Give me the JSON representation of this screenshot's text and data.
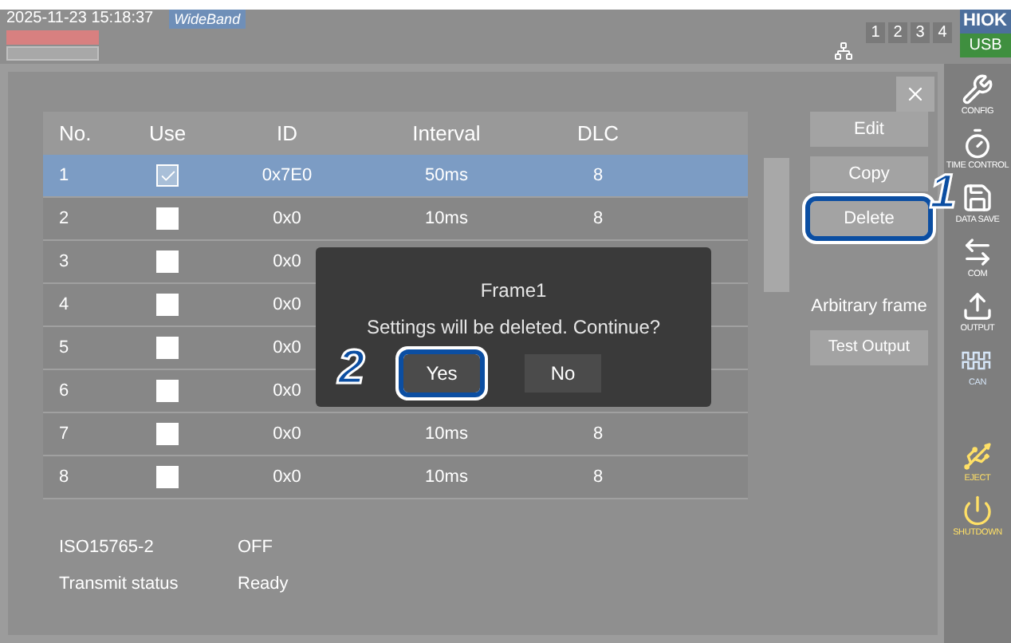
{
  "status_bar": {
    "datetime": "2025-11-23 15:18:37",
    "mode": "WideBand",
    "channels": [
      "1",
      "2",
      "3",
      "4"
    ],
    "logo": "HIOK",
    "usb": "USB"
  },
  "table": {
    "columns": [
      "No.",
      "Use",
      "ID",
      "Interval",
      "DLC"
    ],
    "rows": [
      {
        "no": "1",
        "use": true,
        "id": "0x7E0",
        "interval": "50ms",
        "dlc": "8",
        "selected": true
      },
      {
        "no": "2",
        "use": false,
        "id": "0x0",
        "interval": "10ms",
        "dlc": "8",
        "selected": false
      },
      {
        "no": "3",
        "use": false,
        "id": "0x0",
        "selected": false
      },
      {
        "no": "4",
        "use": false,
        "id": "0x0",
        "selected": false
      },
      {
        "no": "5",
        "use": false,
        "id": "0x0",
        "selected": false
      },
      {
        "no": "6",
        "use": false,
        "id": "0x0",
        "selected": false
      },
      {
        "no": "7",
        "use": false,
        "id": "0x0",
        "interval": "10ms",
        "dlc": "8",
        "selected": false
      },
      {
        "no": "8",
        "use": false,
        "id": "0x0",
        "interval": "10ms",
        "dlc": "8",
        "selected": false
      }
    ]
  },
  "actions": [
    {
      "label": "Edit",
      "highlighted": false
    },
    {
      "label": "Copy",
      "highlighted": false
    },
    {
      "label": "Delete",
      "highlighted": true
    }
  ],
  "arbitrary_frame": {
    "label": "Arbitrary frame",
    "button": "Test Output"
  },
  "info": [
    {
      "label": "ISO15765-2",
      "value": "OFF"
    },
    {
      "label": "Transmit status",
      "value": "Ready"
    }
  ],
  "dialog": {
    "title": "Frame1",
    "message": "Settings will be deleted. Continue?",
    "buttons": [
      {
        "label": "Yes",
        "highlighted": true
      },
      {
        "label": "No",
        "highlighted": false
      }
    ]
  },
  "callouts": [
    "1",
    "2"
  ],
  "sidebar": [
    {
      "kind": "config",
      "label": "CONFIG",
      "color": "#ffffff"
    },
    {
      "kind": "time",
      "label": "TIME CONTROL",
      "color": "#ffffff"
    },
    {
      "kind": "save",
      "label": "DATA SAVE",
      "color": "#ffffff"
    },
    {
      "kind": "com",
      "label": "COM",
      "color": "#ffffff"
    },
    {
      "kind": "output",
      "label": "OUTPUT",
      "color": "#ffffff"
    },
    {
      "kind": "can",
      "label": "CAN",
      "color": "#d6e6f8"
    },
    {
      "kind": "eject",
      "label": "EJECT",
      "color": "#ffe066"
    },
    {
      "kind": "shutdown",
      "label": "SHUTDOWN",
      "color": "#ffe066"
    }
  ]
}
